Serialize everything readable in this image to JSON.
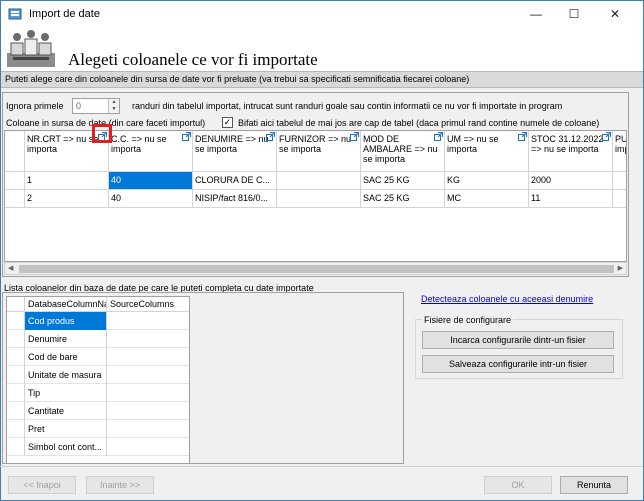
{
  "window": {
    "title": "Import de date",
    "minimize": "—",
    "maximize": "☐",
    "close": "✕"
  },
  "banner": {
    "title": "Alegeti coloanele ce vor fi importate"
  },
  "info": "Puteti alege care din coloanele din sursa de date vor fi preluate (va trebui sa specificati semnificatia fiecarei coloane)",
  "options": {
    "ignore_label": "Ignora primele",
    "ignore_value": "0",
    "ignore_suffix": "randuri din tabelul importat, intrucat sunt randuri goale sau contin informatii ce nu vor fi importate in program",
    "source_columns_label": "Coloane in sursa de date (din care faceti importul)",
    "header_checkbox_label": "Bifati aici tabelul de mai jos are cap de tabel (daca primul rand contine numele de coloane)",
    "header_checked": true
  },
  "source_grid": {
    "columns": [
      "NR.CRT => nu se importa",
      "C.C. => nu se importa",
      "DENUMIRE => nu se importa",
      "FURNIZOR => nu se importa",
      "MOD DE AMBALARE => nu se importa",
      "UM => nu se importa",
      "STOC 31.12.2022 => nu se importa",
      "PU importa"
    ],
    "rows": [
      [
        "1",
        "40",
        "CLORURA DE C...",
        "",
        "SAC 25 KG",
        "KG",
        "2000",
        ""
      ],
      [
        "2",
        "40",
        "NISIP/fact 816/0...",
        "",
        "SAC 25 KG",
        "MC",
        "11",
        ""
      ]
    ]
  },
  "mapping": {
    "label": "Lista coloanelor din baza de date pe care le puteti completa cu date importate",
    "header_db": "DatabaseColumnNa",
    "header_src": "SourceColumns",
    "rows": [
      "Cod produs",
      "Denumire",
      "Cod de bare",
      "Unitate de masura",
      "Tip",
      "Cantitate",
      "Pret",
      "Simbol cont cont..."
    ]
  },
  "detect_link": "Detecteaza coloanele cu aceeasi denumire",
  "config": {
    "group_label": "Fisiere de configurare",
    "load": "Incarca configurarile dintr-un fisier",
    "save": "Salveaza configurarile intr-un fisier"
  },
  "footer": {
    "back": "<< Inapoi",
    "next": "Inainte >>",
    "ok": "OK",
    "cancel": "Renunta"
  }
}
